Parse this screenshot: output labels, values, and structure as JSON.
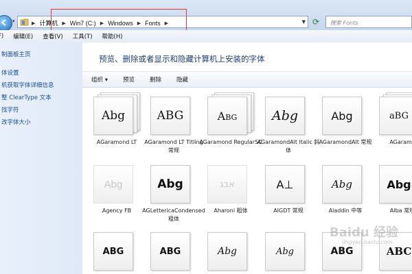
{
  "address": {
    "crumbs": [
      "计算机",
      "Win7 (C:)",
      "Windows",
      "Fonts"
    ],
    "search_placeholder": "搜索 Fonts"
  },
  "menu": [
    "F)",
    "编辑(E)",
    "查看(V)",
    "工具(T)",
    "帮助(H)"
  ],
  "sidebar": {
    "items": [
      "制面板主页",
      "体设置",
      "机获取字体详细信息",
      "整 ClearType 文本",
      "找字符",
      "改字体大小"
    ]
  },
  "main": {
    "title": "预览、删除或者显示和隐藏计算机上安装的字体",
    "toolbar": {
      "organize": "组织 ▾",
      "preview": "预览",
      "delete": "删除",
      "hide": "隐藏"
    }
  },
  "fonts": [
    {
      "sample": "Abg",
      "name": "AGaramond LT",
      "family_group": true
    },
    {
      "sample": "ABG",
      "name": "AGaramond LT Titling 常规"
    },
    {
      "sample": "Abg",
      "name": "AGaramond RegularSC",
      "family_group": true
    },
    {
      "sample": "Abg",
      "name": "AGaramondAlt Italic 斜体"
    },
    {
      "sample": "Abg",
      "name": "AGaramondAlt 常规"
    },
    {
      "sample": "aBG",
      "name": "AGaramo",
      "family_group": true
    },
    {
      "sample": "Abg",
      "name": "Agency FB",
      "faded": true
    },
    {
      "sample": "Abg",
      "name": "AGLettericaCondensed 粗体"
    },
    {
      "sample": "אבג",
      "name": "Aharoni 粗体",
      "faded": true
    },
    {
      "sample": "A⊥",
      "name": "AIGDT 常规"
    },
    {
      "sample": "Abg",
      "name": "Aladdin 中等"
    },
    {
      "sample": "Abg",
      "name": "Alba 常规"
    },
    {
      "sample": "ABG",
      "name": ""
    },
    {
      "sample": "ABG",
      "name": ""
    },
    {
      "sample": "Abg",
      "name": ""
    },
    {
      "sample": "Abg",
      "name": ""
    },
    {
      "sample": "ABG",
      "name": ""
    },
    {
      "sample": "ABC",
      "name": ""
    }
  ],
  "watermark": {
    "text": "Baidu 经验",
    "sub": "jingyan.baidu.com"
  }
}
